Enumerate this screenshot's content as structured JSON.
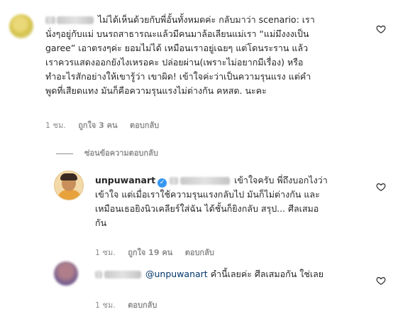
{
  "comment1": {
    "lines": [
      "ไม่ได้เห็นด้วยกับพี่อั้นทั้งหมดค่ะ กลับมาว่า scenario: เรา",
      "นั่งๆอยู่กับแม่ บนรถสาธารณะแล้วมีคนมาล้อเลียนแม่เรา “แม่มึงงงเป็น",
      "garee” เอาตรงๆค่ะ ยอมไม่ได้ เหมือนเราอยู่เฉยๆ แต่โดนระราน แล้ว",
      "เราควรแสดงออกยังไงเหรอคะ ปล่อยผ่าน(เพราะไม่อยากมีเรื่อง) หรือ",
      "ทำอะไรสักอย่างให้เขารู้ว่า เขาผิด! เข้าใจค่ะว่าเป็นความรุนแรง แต่คำ",
      "พูดที่เสียดแทง มันก็คือความรุนแรงไม่ต่างกัน คหสต. นะคะ"
    ],
    "time": "1 ชม.",
    "likes": "ถูกใจ 3 คน",
    "reply": "ตอบกลับ"
  },
  "view_replies": "ซ่อนข้อความตอบกลับ",
  "reply1": {
    "username": "unpuwanart",
    "first_line": "เข้าใจครับ พี่ถึงบอกไงว่า",
    "lines": [
      "เข้าใจ แต่เมื่อเราใช้ความรุนแรงกลับไป มันก็ไม่ต่างกัน และ",
      "เหมือนเธอยิงนิวเคลียร์ใส่ฉัน ได้ชั้นก็ยิงกลับ สรุป... ศีลเสมอ",
      "กัน"
    ],
    "time": "1 ชม.",
    "likes": "ถูกใจ 19 คน",
    "reply": "ตอบกลับ"
  },
  "reply2": {
    "mention": "@unpuwanart",
    "text": " คำนี้เลยค่ะ ศีลเสมอกัน ใช่เลย",
    "time": "1 ชม.",
    "reply": "ตอบกลับ"
  },
  "icons": {
    "heart": "heart-outline-icon",
    "verified": "verified-badge-icon"
  },
  "colors": {
    "text": "#262626",
    "meta": "#8e8e8e",
    "verified": "#3897f0",
    "mention": "#00376b"
  }
}
